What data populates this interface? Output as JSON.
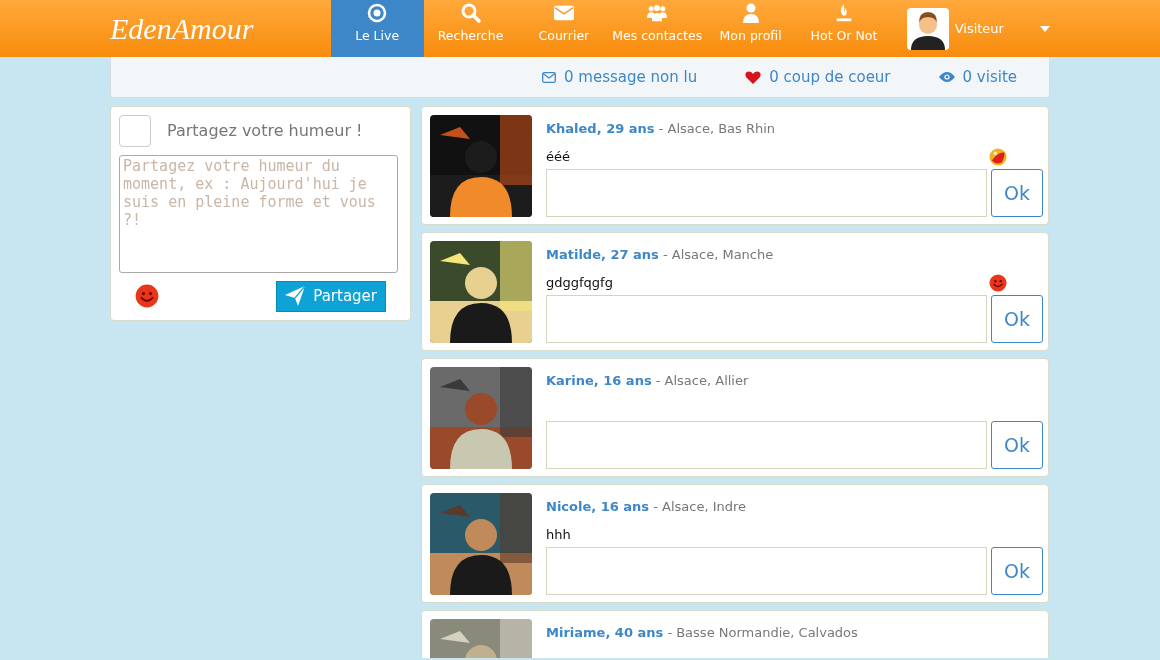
{
  "logo": "EdenAmour",
  "nav": [
    {
      "label": "Le Live",
      "selected": true
    },
    {
      "label": "Recherche",
      "selected": false
    },
    {
      "label": "Courrier",
      "selected": false
    },
    {
      "label": "Mes contactes",
      "selected": false
    },
    {
      "label": "Mon profil",
      "selected": false
    },
    {
      "label": "Hot Or Not",
      "selected": false
    }
  ],
  "user": {
    "name": "Visiteur"
  },
  "stats": [
    "0 message non lu",
    "0 coup de coeur",
    "0 visite"
  ],
  "mood_panel": {
    "title": "Partagez votre humeur !",
    "placeholder": "Partagez votre humeur du moment, ex : Aujourd'hui je suis en pleine forme et vous ?!",
    "button": "Partager"
  },
  "posts": [
    {
      "name": "Khaled, 29 ans",
      "location": " - Alsace, Bas Rhin",
      "message": "ééé",
      "mood_icon": {
        "kind": "ball"
      },
      "button": "Ok"
    },
    {
      "name": "Matilde, 27 ans",
      "location": " - Alsace, Manche",
      "message": "gdggfqgfg",
      "mood_icon": {
        "kind": "smiley"
      },
      "button": "Ok"
    },
    {
      "name": "Karine, 16 ans",
      "location": " - Alsace, Allier",
      "button": "Ok"
    },
    {
      "name": "Nicole, 16 ans",
      "location": " - Alsace, Indre",
      "message": "hhh",
      "button": "Ok"
    },
    {
      "name": "Miriame, 40 ans",
      "location": " - Basse Normandie, Calvados"
    }
  ]
}
